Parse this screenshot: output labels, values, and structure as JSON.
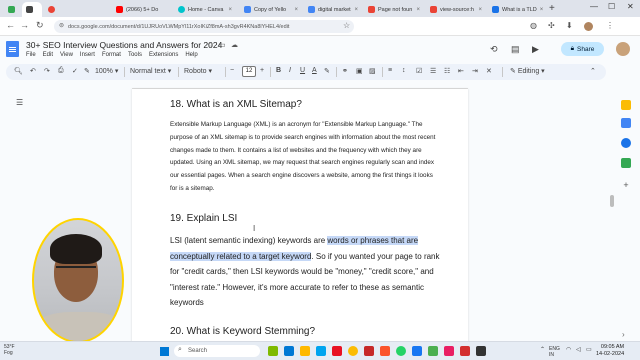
{
  "browser": {
    "tabs": [
      {
        "label": "",
        "color": "#34a853"
      },
      {
        "label": "",
        "color": "#444444"
      },
      {
        "label": "(2066) 5+ Do",
        "color": "#ff0000"
      },
      {
        "label": "Home - Canva",
        "color": "#00c4cc"
      },
      {
        "label": "Copy of Yello",
        "color": "#4285f4"
      },
      {
        "label": "digital market",
        "color": "#4285f4"
      },
      {
        "label": "Page not foun",
        "color": "#ea4335"
      },
      {
        "label": "view-source:h",
        "color": "#ea4335"
      },
      {
        "label": "What is a TLD",
        "color": "#1a73e8"
      }
    ],
    "url": "docs.google.com/document/d/1UJRUoVLWMpYl11rXoIKiZf8mA-sh3gvR4KNa8lYHEL4/edit"
  },
  "doc": {
    "title": "30+ SEO Interview Questions and Answers for 2024",
    "menus": [
      "File",
      "Edit",
      "View",
      "Insert",
      "Format",
      "Tools",
      "Extensions",
      "Help"
    ],
    "share_label": "Share"
  },
  "toolbar": {
    "zoom": "100%",
    "style": "Normal text",
    "font": "Roboto",
    "font_size": "12",
    "mode": "Editing"
  },
  "content": {
    "h18": "18. What is an XML Sitemap?",
    "p18": "Extensible Markup Language (XML) is an acronym for \"Extensible Markup Language.\" The purpose of an XML sitemap is to provide search engines with information about the most recent changes made to them. It contains a list of websites and the frequency with which they are updated. Using an XML sitemap, we may request that search engines regularly scan and index our essential pages. When a search engine discovers a website, among the first things it looks for is a sitemap.",
    "h19": "19. Explain LSI",
    "p19_before": "LSI (latent semantic indexing) keywords are ",
    "p19_highlight": "words or phrases that are conceptually related to a target keyword",
    "p19_after": ". So if you wanted your page to rank for \"credit cards,\" then LSI keywords would be \"money,\" \"credit score,\" and \"interest rate.\" However, it's more accurate to refer to these as semantic keywords",
    "h20": "20. What is Keyword Stemming?"
  },
  "taskbar": {
    "temp": "53°F",
    "weather": "Fog",
    "search_placeholder": "Search",
    "lang": "ENG",
    "region": "IN",
    "time": "09:05 AM",
    "date": "14-02-2024"
  }
}
